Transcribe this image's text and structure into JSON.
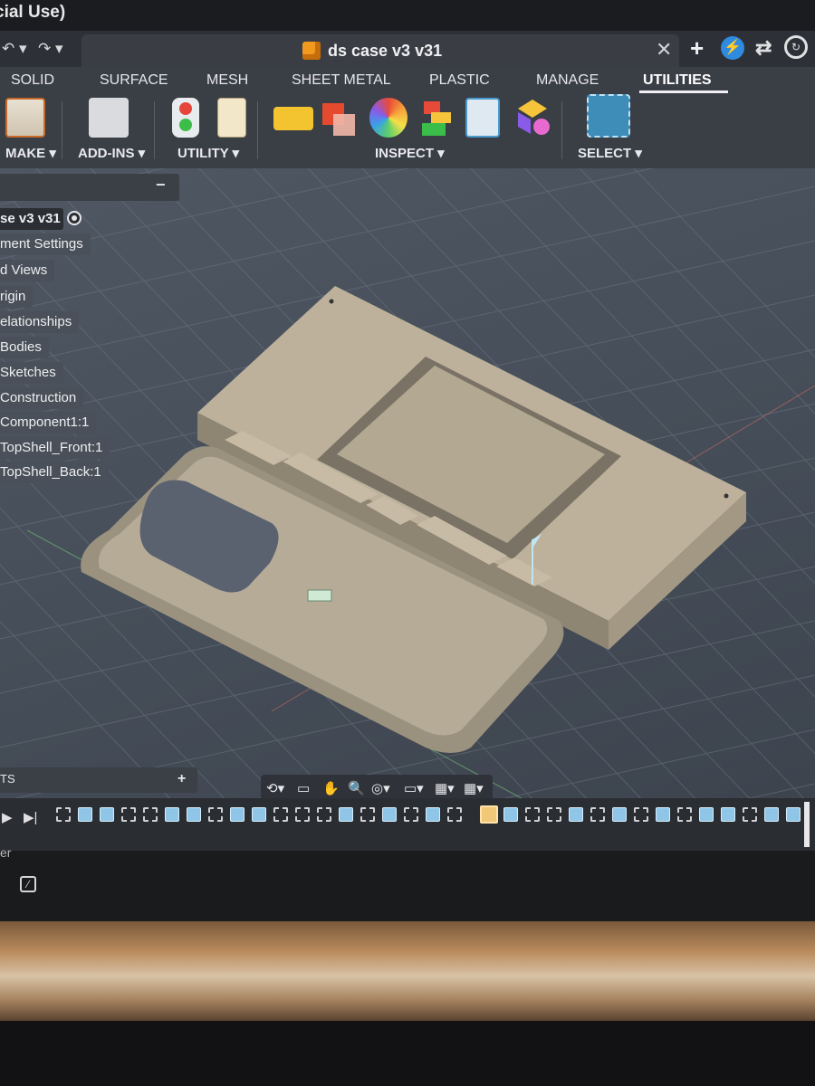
{
  "app": {
    "title": "cial Use)"
  },
  "document": {
    "title": "ds case v3 v31",
    "close_label": "✕",
    "new_tab_label": "+"
  },
  "toolbar_right": {
    "bolt_icon": "lightning-icon",
    "activity_icon": "clock-icon"
  },
  "ribbon": {
    "tabs": [
      {
        "label": "SOLID"
      },
      {
        "label": "SURFACE"
      },
      {
        "label": "MESH"
      },
      {
        "label": "SHEET METAL"
      },
      {
        "label": "PLASTIC"
      },
      {
        "label": "MANAGE"
      },
      {
        "label": "UTILITIES"
      }
    ],
    "active_tab": "UTILITIES",
    "groups": [
      {
        "label": "MAKE ▾"
      },
      {
        "label": "ADD-INS ▾"
      },
      {
        "label": "UTILITY ▾"
      },
      {
        "label": "INSPECT ▾"
      },
      {
        "label": "SELECT ▾"
      }
    ]
  },
  "browser": {
    "collapse_label": "−",
    "items": [
      {
        "label": "se v3 v31"
      },
      {
        "label": "ment Settings"
      },
      {
        "label": "d Views"
      },
      {
        "label": "rigin"
      },
      {
        "label": "elationships"
      },
      {
        "label": "Bodies"
      },
      {
        "label": "Sketches"
      },
      {
        "label": "Construction"
      },
      {
        "label": "Component1:1"
      },
      {
        "label": "TopShell_Front:1"
      },
      {
        "label": "TopShell_Back:1"
      }
    ]
  },
  "comments": {
    "label": "TS",
    "add_label": "+"
  },
  "lower": {
    "text": "er"
  },
  "colors": {
    "accent": "#2f8be0",
    "body_tan": "#b9ad98",
    "viewport_bg": "#4a525d"
  }
}
